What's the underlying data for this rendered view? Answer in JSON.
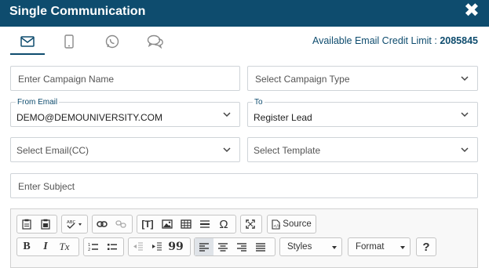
{
  "header": {
    "title": "Single Communication",
    "close_glyph": "✖"
  },
  "tabs": [
    {
      "name": "email",
      "icon": "envelope-icon",
      "active": true
    },
    {
      "name": "sms",
      "icon": "mobile-phone-icon",
      "active": false
    },
    {
      "name": "whatsapp",
      "icon": "whatsapp-icon",
      "active": false
    },
    {
      "name": "chat",
      "icon": "chat-bubbles-icon",
      "active": false
    }
  ],
  "credit": {
    "label": "Available Email Credit Limit : ",
    "value": "2085845"
  },
  "form": {
    "campaign_name_placeholder": "Enter Campaign Name",
    "campaign_type_placeholder": "Select Campaign Type",
    "from_email_label": "From Email",
    "from_email_value": "DEMO@DEMOUNIVERSITY.COM",
    "to_label": "To",
    "to_value": "Register Lead",
    "cc_placeholder": "Select Email(CC)",
    "template_placeholder": "Select Template",
    "subject_placeholder": "Enter Subject"
  },
  "editor": {
    "source_label": "Source",
    "styles_label": "Styles",
    "format_label": "Format",
    "help_label": "?",
    "bold_label": "B",
    "italic_label": "I",
    "clear_label": "Tx",
    "blockquote_label": "99",
    "special_char_label": "Ω",
    "textfield_label": "[T]"
  },
  "colors": {
    "header_bg": "#0e4c6e",
    "accent": "#0e4c6e"
  }
}
